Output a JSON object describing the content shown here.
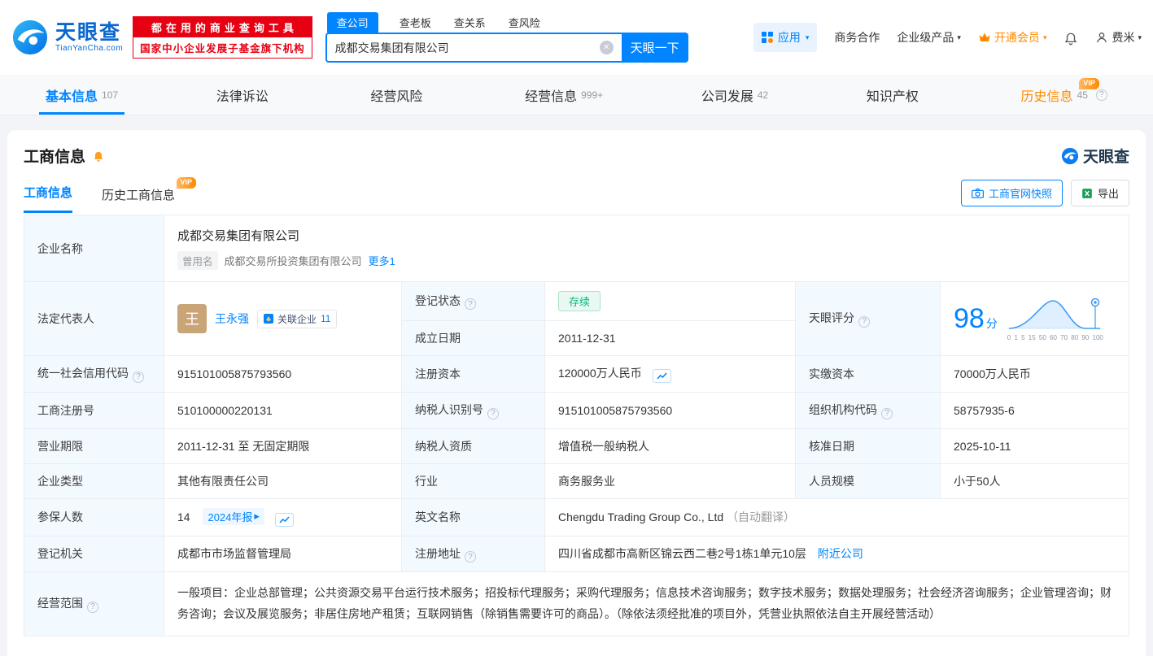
{
  "icons": {
    "caret": "▾",
    "question": "?",
    "clear": "✕",
    "arrow_right": "▸"
  },
  "header": {
    "logo": {
      "brand": "天眼查",
      "domain": "TianYanCha.com"
    },
    "banner": {
      "line1": "都在用的商业查询工具",
      "line2": "国家中小企业发展子基金旗下机构"
    },
    "search_tabs": [
      {
        "label": "查公司"
      },
      {
        "label": "查老板"
      },
      {
        "label": "查关系"
      },
      {
        "label": "查风险"
      }
    ],
    "search": {
      "value": "成都交易集团有限公司",
      "button": "天眼一下"
    },
    "menu": {
      "apps": "应用",
      "cooperation": "商务合作",
      "enterprise": "企业级产品",
      "vip": "开通会员",
      "user": "费米"
    }
  },
  "nav": {
    "vip_badge": "VIP",
    "items": [
      {
        "label": "基本信息",
        "count": "107"
      },
      {
        "label": "法律诉讼",
        "count": ""
      },
      {
        "label": "经营风险",
        "count": ""
      },
      {
        "label": "经营信息",
        "count": "999+"
      },
      {
        "label": "公司发展",
        "count": "42"
      },
      {
        "label": "知识产权",
        "count": ""
      },
      {
        "label": "历史信息",
        "count": "45"
      }
    ]
  },
  "section": {
    "title": "工商信息",
    "brand": "天眼查",
    "vip_badge": "VIP",
    "tabs": {
      "current": "工商信息",
      "history": "历史工商信息"
    },
    "snapshot_button": "工商官网快照",
    "export_button": "导出"
  },
  "company": {
    "name": "成都交易集团有限公司",
    "former_label": "曾用名",
    "former_name": "成都交易所投资集团有限公司",
    "more_link": "更多1",
    "legal_rep": "王永强",
    "legal_rep_initial": "王",
    "related_label": "关联企业",
    "related_count": "11"
  },
  "fields": {
    "name_label": "企业名称",
    "legal_rep_label": "法定代表人",
    "reg_status_label": "登记状态",
    "reg_status": "存续",
    "established_label": "成立日期",
    "established": "2011-12-31",
    "score_label": "天眼评分",
    "score": "98",
    "score_unit": "分",
    "score_axis": "0 1 5 15 50 60 70 80 90 100",
    "credit_code_label": "统一社会信用代码",
    "credit_code": "915101005875793560",
    "reg_capital_label": "注册资本",
    "reg_capital": "120000万人民币",
    "paid_capital_label": "实缴资本",
    "paid_capital": "70000万人民币",
    "reg_number_label": "工商注册号",
    "reg_number": "510100000220131",
    "taxpayer_id_label": "纳税人识别号",
    "taxpayer_id": "915101005875793560",
    "org_code_label": "组织机构代码",
    "org_code": "58757935-6",
    "term_label": "营业期限",
    "term": "2011-12-31 至 无固定期限",
    "taxpayer_quality_label": "纳税人资质",
    "taxpayer_quality": "增值税一般纳税人",
    "approval_label": "核准日期",
    "approval": "2025-10-11",
    "type_label": "企业类型",
    "type": "其他有限责任公司",
    "industry_label": "行业",
    "industry": "商务服务业",
    "staff_label": "人员规模",
    "staff": "小于50人",
    "insured_label": "参保人数",
    "insured": "14",
    "annual_report": "2024年报",
    "english_label": "英文名称",
    "english_name": "Chengdu Trading Group Co., Ltd",
    "english_note": "（自动翻译）",
    "authority_label": "登记机关",
    "authority": "成都市市场监督管理局",
    "address_label": "注册地址",
    "address": "四川省成都市高新区锦云西二巷2号1栋1单元10层",
    "nearby_link": "附近公司",
    "scope_label": "经营范围",
    "scope": "一般项目：企业总部管理；公共资源交易平台运行技术服务；招投标代理服务；采购代理服务；信息技术咨询服务；数字技术服务；数据处理服务；社会经济咨询服务；企业管理咨询；财务咨询；会议及展览服务；非居住房地产租赁；互联网销售（除销售需要许可的商品）。（除依法须经批准的项目外，凭营业执照依法自主开展经营活动）"
  }
}
